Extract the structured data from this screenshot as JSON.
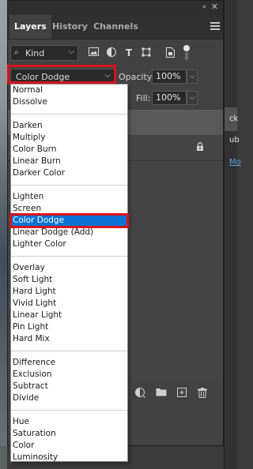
{
  "panel": {
    "tabs": [
      {
        "label": "Layers",
        "active": true
      },
      {
        "label": "History",
        "active": false
      },
      {
        "label": "Channels",
        "active": false
      }
    ],
    "collapse_glyph": "«",
    "close_glyph": "✕"
  },
  "filter": {
    "kind_label": "Kind",
    "icons": [
      "image-filter-icon",
      "adjustment-filter-icon",
      "type-filter-icon",
      "shape-filter-icon",
      "smart-object-filter-icon"
    ]
  },
  "blend": {
    "mode": "Color Dodge",
    "opacity_label": "Opacity:",
    "opacity_value": "100%",
    "fill_label": "Fill:",
    "fill_value": "100%"
  },
  "dropdown": {
    "groups": [
      [
        "Normal",
        "Dissolve"
      ],
      [
        "Darken",
        "Multiply",
        "Color Burn",
        "Linear Burn",
        "Darker Color"
      ],
      [
        "Lighten",
        "Screen",
        "Color Dodge",
        "Linear Dodge (Add)",
        "Lighter Color"
      ],
      [
        "Overlay",
        "Soft Light",
        "Hard Light",
        "Vivid Light",
        "Linear Light",
        "Pin Light",
        "Hard Mix"
      ],
      [
        "Difference",
        "Exclusion",
        "Subtract",
        "Divide"
      ],
      [
        "Hue",
        "Saturation",
        "Color",
        "Luminosity"
      ]
    ],
    "selected": "Color Dodge"
  },
  "background_fragments": [
    "ck",
    "ub",
    "Mo"
  ],
  "colors": {
    "highlight": "#d8141e",
    "selection": "#0b72d4"
  }
}
